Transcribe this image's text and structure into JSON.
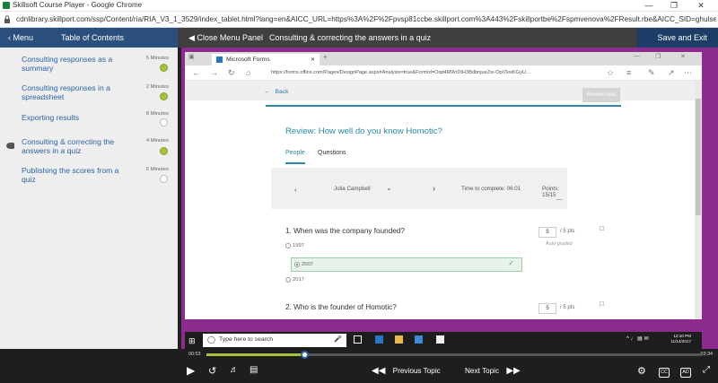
{
  "browser": {
    "window_title": "Skillsoft Course Player - Google Chrome",
    "url": "cdnlibrary.skillport.com/ssp/Content/ria/RIA_V3_1_3529/index_tablet.html?lang=en&AICC_URL=https%3A%2F%2Fpvsp81ccbe.skillport.com%3A443%2Fskillportbe%2Fspmvenova%2FResult.rbe&AICC_SID=ghulse..."
  },
  "header": {
    "menu_label": "Menu",
    "toc_label": "Table of Contents",
    "close_panel_label": "Close Menu Panel",
    "topic_title": "Consulting & correcting the answers in a quiz",
    "save_exit_label": "Save and Exit"
  },
  "sidebar": {
    "items": [
      {
        "label": "Consulting responses as a summary",
        "duration": "5 Minutes",
        "status": "done"
      },
      {
        "label": "Consulting responses in a spreadsheet",
        "duration": "2 Minutes",
        "status": "done"
      },
      {
        "label": "Exporting results",
        "duration": "8 Minutes",
        "status": "todo"
      },
      {
        "label": "Consulting & correcting the answers in a quiz",
        "duration": "4 Minutes",
        "status": "done",
        "current": true
      },
      {
        "label": "Publishing the scores from a quiz",
        "duration": "5 Minutes",
        "status": "todo"
      }
    ]
  },
  "inner_browser": {
    "tab_title": "Microsoft Forms",
    "url": "https://forms.office.com/Pages/DesignPage.aspx#Analysis=true&FormId=Oqd4MWrDtH3BdbnjueZw-Opt7kwKGyU..."
  },
  "form": {
    "back_label": "Back",
    "review_button": "Review next",
    "title": "Review: How well do you know Homotic?",
    "tabs": [
      "People",
      "Questions"
    ],
    "respondent": "Julia Campbell",
    "time_to_complete": "Time to complete: 06:01",
    "points": "Points: 15/15",
    "q1": {
      "text": "1. When was the company founded?",
      "options": [
        "1997",
        "2007",
        "2017"
      ],
      "selected": "2007",
      "score": "5",
      "max": "/ 5 pts",
      "auto_graded": "Auto-graded"
    },
    "q2": {
      "text": "2. Who is the founder of Homotic?",
      "score": "5",
      "max": "/ 5 pts"
    }
  },
  "taskbar": {
    "search_placeholder": "Type here to search",
    "time": "12:10 PM",
    "date": "11/14/2017"
  },
  "player": {
    "elapsed": "00:53",
    "total": "03:34",
    "progress_fraction": 0.2,
    "prev_label": "Previous Topic",
    "next_label": "Next Topic",
    "cc_label": "CC",
    "ad_label": "AD"
  },
  "colors": {
    "header_blue": "#1b3d66",
    "link_blue": "#2a63a6",
    "complete_green": "#a5c23a",
    "stage_purple": "#8e2b8e",
    "forms_teal": "#2a8aa4"
  }
}
